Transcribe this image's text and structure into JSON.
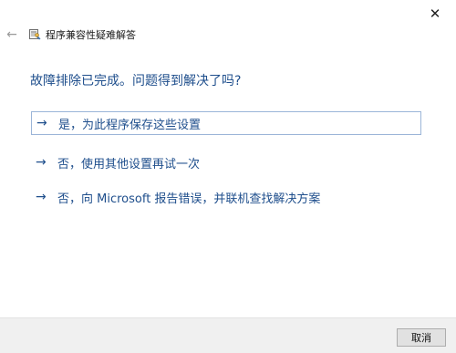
{
  "window": {
    "title": "程序兼容性疑难解答",
    "close_glyph": "✕",
    "back_glyph": "←",
    "back_icon": "back-arrow-icon",
    "app_icon": "troubleshooter-app-icon"
  },
  "main": {
    "heading": "故障排除已完成。问题得到解决了吗?",
    "options": [
      {
        "arrow": "→",
        "label": "是，为此程序保存这些设置"
      },
      {
        "arrow": "→",
        "label": "否，使用其他设置再试一次"
      },
      {
        "arrow": "→",
        "label": "否，向 Microsoft 报告错误，并联机查找解决方案"
      }
    ]
  },
  "footer": {
    "cancel_label": "取消"
  },
  "colors": {
    "accent_text": "#1e4e8c",
    "footer_bg": "#f0f0f0"
  }
}
